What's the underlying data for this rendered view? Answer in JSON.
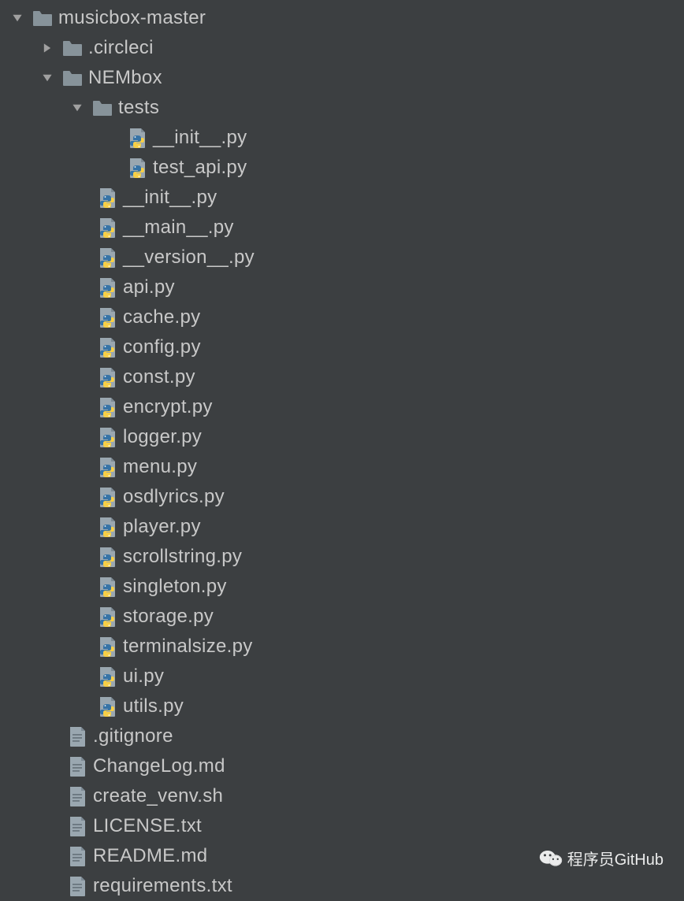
{
  "tree": [
    {
      "name": "musicbox-master",
      "type": "folder",
      "expanded": true,
      "level": 0
    },
    {
      "name": ".circleci",
      "type": "folder",
      "expanded": false,
      "level": 1
    },
    {
      "name": "NEMbox",
      "type": "folder",
      "expanded": true,
      "level": 1
    },
    {
      "name": "tests",
      "type": "folder",
      "expanded": true,
      "level": 2
    },
    {
      "name": "__init__.py",
      "type": "python",
      "level": 3
    },
    {
      "name": "test_api.py",
      "type": "python",
      "level": 3
    },
    {
      "name": "__init__.py",
      "type": "python",
      "level": 2
    },
    {
      "name": "__main__.py",
      "type": "python",
      "level": 2
    },
    {
      "name": "__version__.py",
      "type": "python",
      "level": 2
    },
    {
      "name": "api.py",
      "type": "python",
      "level": 2
    },
    {
      "name": "cache.py",
      "type": "python",
      "level": 2
    },
    {
      "name": "config.py",
      "type": "python",
      "level": 2
    },
    {
      "name": "const.py",
      "type": "python",
      "level": 2
    },
    {
      "name": "encrypt.py",
      "type": "python",
      "level": 2
    },
    {
      "name": "logger.py",
      "type": "python",
      "level": 2
    },
    {
      "name": "menu.py",
      "type": "python",
      "level": 2
    },
    {
      "name": "osdlyrics.py",
      "type": "python",
      "level": 2
    },
    {
      "name": "player.py",
      "type": "python",
      "level": 2
    },
    {
      "name": "scrollstring.py",
      "type": "python",
      "level": 2
    },
    {
      "name": "singleton.py",
      "type": "python",
      "level": 2
    },
    {
      "name": "storage.py",
      "type": "python",
      "level": 2
    },
    {
      "name": "terminalsize.py",
      "type": "python",
      "level": 2
    },
    {
      "name": "ui.py",
      "type": "python",
      "level": 2
    },
    {
      "name": "utils.py",
      "type": "python",
      "level": 2
    },
    {
      "name": ".gitignore",
      "type": "text",
      "level": 1
    },
    {
      "name": "ChangeLog.md",
      "type": "text",
      "level": 1
    },
    {
      "name": "create_venv.sh",
      "type": "text",
      "level": 1
    },
    {
      "name": "LICENSE.txt",
      "type": "text",
      "level": 1
    },
    {
      "name": "README.md",
      "type": "text",
      "level": 1
    },
    {
      "name": "requirements.txt",
      "type": "text",
      "level": 1
    }
  ],
  "watermark": "程序员GitHub"
}
